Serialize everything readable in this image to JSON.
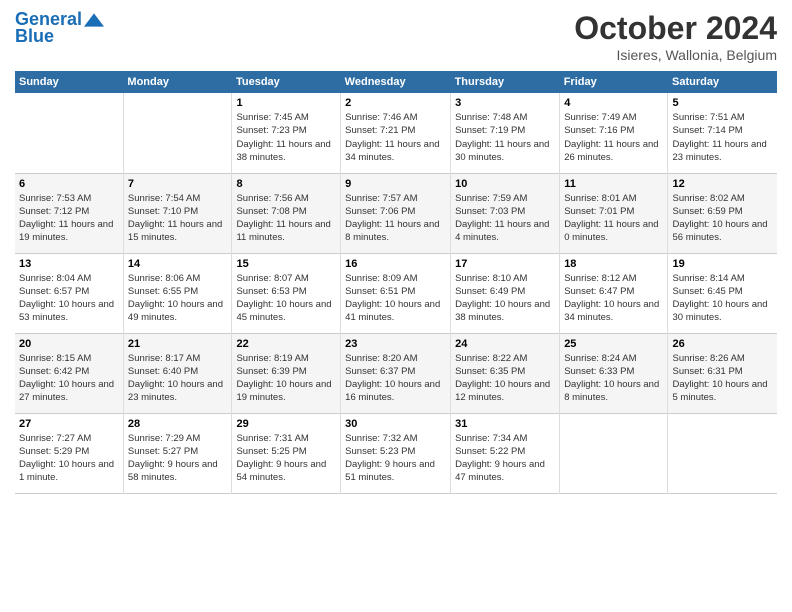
{
  "header": {
    "logo_line1": "General",
    "logo_line2": "Blue",
    "month": "October 2024",
    "location": "Isieres, Wallonia, Belgium"
  },
  "days_of_week": [
    "Sunday",
    "Monday",
    "Tuesday",
    "Wednesday",
    "Thursday",
    "Friday",
    "Saturday"
  ],
  "weeks": [
    [
      {
        "num": "",
        "info": ""
      },
      {
        "num": "",
        "info": ""
      },
      {
        "num": "1",
        "info": "Sunrise: 7:45 AM\nSunset: 7:23 PM\nDaylight: 11 hours and 38 minutes."
      },
      {
        "num": "2",
        "info": "Sunrise: 7:46 AM\nSunset: 7:21 PM\nDaylight: 11 hours and 34 minutes."
      },
      {
        "num": "3",
        "info": "Sunrise: 7:48 AM\nSunset: 7:19 PM\nDaylight: 11 hours and 30 minutes."
      },
      {
        "num": "4",
        "info": "Sunrise: 7:49 AM\nSunset: 7:16 PM\nDaylight: 11 hours and 26 minutes."
      },
      {
        "num": "5",
        "info": "Sunrise: 7:51 AM\nSunset: 7:14 PM\nDaylight: 11 hours and 23 minutes."
      }
    ],
    [
      {
        "num": "6",
        "info": "Sunrise: 7:53 AM\nSunset: 7:12 PM\nDaylight: 11 hours and 19 minutes."
      },
      {
        "num": "7",
        "info": "Sunrise: 7:54 AM\nSunset: 7:10 PM\nDaylight: 11 hours and 15 minutes."
      },
      {
        "num": "8",
        "info": "Sunrise: 7:56 AM\nSunset: 7:08 PM\nDaylight: 11 hours and 11 minutes."
      },
      {
        "num": "9",
        "info": "Sunrise: 7:57 AM\nSunset: 7:06 PM\nDaylight: 11 hours and 8 minutes."
      },
      {
        "num": "10",
        "info": "Sunrise: 7:59 AM\nSunset: 7:03 PM\nDaylight: 11 hours and 4 minutes."
      },
      {
        "num": "11",
        "info": "Sunrise: 8:01 AM\nSunset: 7:01 PM\nDaylight: 11 hours and 0 minutes."
      },
      {
        "num": "12",
        "info": "Sunrise: 8:02 AM\nSunset: 6:59 PM\nDaylight: 10 hours and 56 minutes."
      }
    ],
    [
      {
        "num": "13",
        "info": "Sunrise: 8:04 AM\nSunset: 6:57 PM\nDaylight: 10 hours and 53 minutes."
      },
      {
        "num": "14",
        "info": "Sunrise: 8:06 AM\nSunset: 6:55 PM\nDaylight: 10 hours and 49 minutes."
      },
      {
        "num": "15",
        "info": "Sunrise: 8:07 AM\nSunset: 6:53 PM\nDaylight: 10 hours and 45 minutes."
      },
      {
        "num": "16",
        "info": "Sunrise: 8:09 AM\nSunset: 6:51 PM\nDaylight: 10 hours and 41 minutes."
      },
      {
        "num": "17",
        "info": "Sunrise: 8:10 AM\nSunset: 6:49 PM\nDaylight: 10 hours and 38 minutes."
      },
      {
        "num": "18",
        "info": "Sunrise: 8:12 AM\nSunset: 6:47 PM\nDaylight: 10 hours and 34 minutes."
      },
      {
        "num": "19",
        "info": "Sunrise: 8:14 AM\nSunset: 6:45 PM\nDaylight: 10 hours and 30 minutes."
      }
    ],
    [
      {
        "num": "20",
        "info": "Sunrise: 8:15 AM\nSunset: 6:42 PM\nDaylight: 10 hours and 27 minutes."
      },
      {
        "num": "21",
        "info": "Sunrise: 8:17 AM\nSunset: 6:40 PM\nDaylight: 10 hours and 23 minutes."
      },
      {
        "num": "22",
        "info": "Sunrise: 8:19 AM\nSunset: 6:39 PM\nDaylight: 10 hours and 19 minutes."
      },
      {
        "num": "23",
        "info": "Sunrise: 8:20 AM\nSunset: 6:37 PM\nDaylight: 10 hours and 16 minutes."
      },
      {
        "num": "24",
        "info": "Sunrise: 8:22 AM\nSunset: 6:35 PM\nDaylight: 10 hours and 12 minutes."
      },
      {
        "num": "25",
        "info": "Sunrise: 8:24 AM\nSunset: 6:33 PM\nDaylight: 10 hours and 8 minutes."
      },
      {
        "num": "26",
        "info": "Sunrise: 8:26 AM\nSunset: 6:31 PM\nDaylight: 10 hours and 5 minutes."
      }
    ],
    [
      {
        "num": "27",
        "info": "Sunrise: 7:27 AM\nSunset: 5:29 PM\nDaylight: 10 hours and 1 minute."
      },
      {
        "num": "28",
        "info": "Sunrise: 7:29 AM\nSunset: 5:27 PM\nDaylight: 9 hours and 58 minutes."
      },
      {
        "num": "29",
        "info": "Sunrise: 7:31 AM\nSunset: 5:25 PM\nDaylight: 9 hours and 54 minutes."
      },
      {
        "num": "30",
        "info": "Sunrise: 7:32 AM\nSunset: 5:23 PM\nDaylight: 9 hours and 51 minutes."
      },
      {
        "num": "31",
        "info": "Sunrise: 7:34 AM\nSunset: 5:22 PM\nDaylight: 9 hours and 47 minutes."
      },
      {
        "num": "",
        "info": ""
      },
      {
        "num": "",
        "info": ""
      }
    ]
  ]
}
